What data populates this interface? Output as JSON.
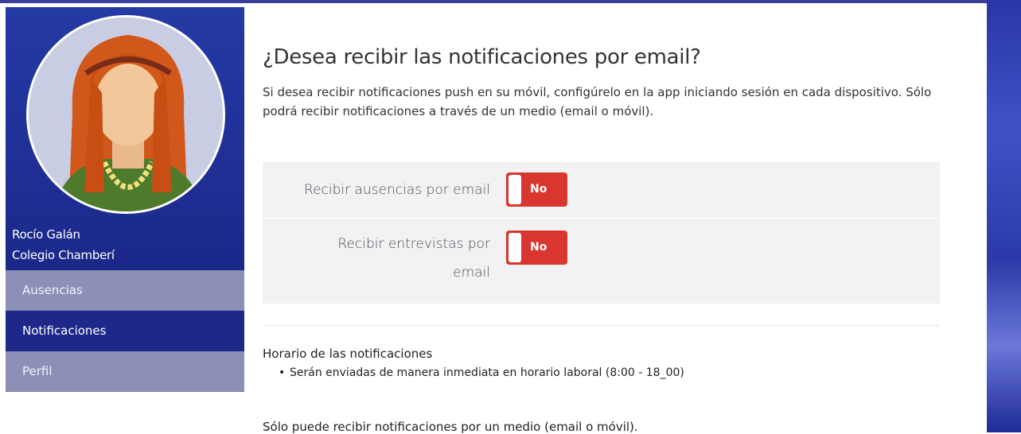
{
  "user": {
    "name": "Rocío Galán",
    "school": "Colegio Chamberí"
  },
  "nav": {
    "items": [
      {
        "label": "Ausencias",
        "active": false
      },
      {
        "label": "Notificaciones",
        "active": true
      },
      {
        "label": "Perfil",
        "active": false
      }
    ]
  },
  "main": {
    "title": "¿Desea recibir las notificaciones por email?",
    "intro": "Si desea recibir notificaciones push en su móvil, configúrelo en la app iniciando sesión en cada dispositivo. Sólo podrá recibir notificaciones a través de un medio (email o móvil).",
    "settings": [
      {
        "label": "Recibir ausencias por email",
        "toggle": "No"
      },
      {
        "label": "Recibir entrevistas por email",
        "toggle": "No"
      }
    ],
    "schedule_title": "Horario de las notificaciones",
    "schedule_items": [
      "Serán enviadas de manera inmediata en horario laboral (8:00 - 18_00)"
    ],
    "footnote": "Sólo puede recibir notificaciones por un medio (email o móvil)."
  },
  "colors": {
    "sidebar_blue": "#1f2f95",
    "nav_active": "#1e2889",
    "nav_inactive": "#8c90b7",
    "toggle_off": "#d9362f"
  }
}
